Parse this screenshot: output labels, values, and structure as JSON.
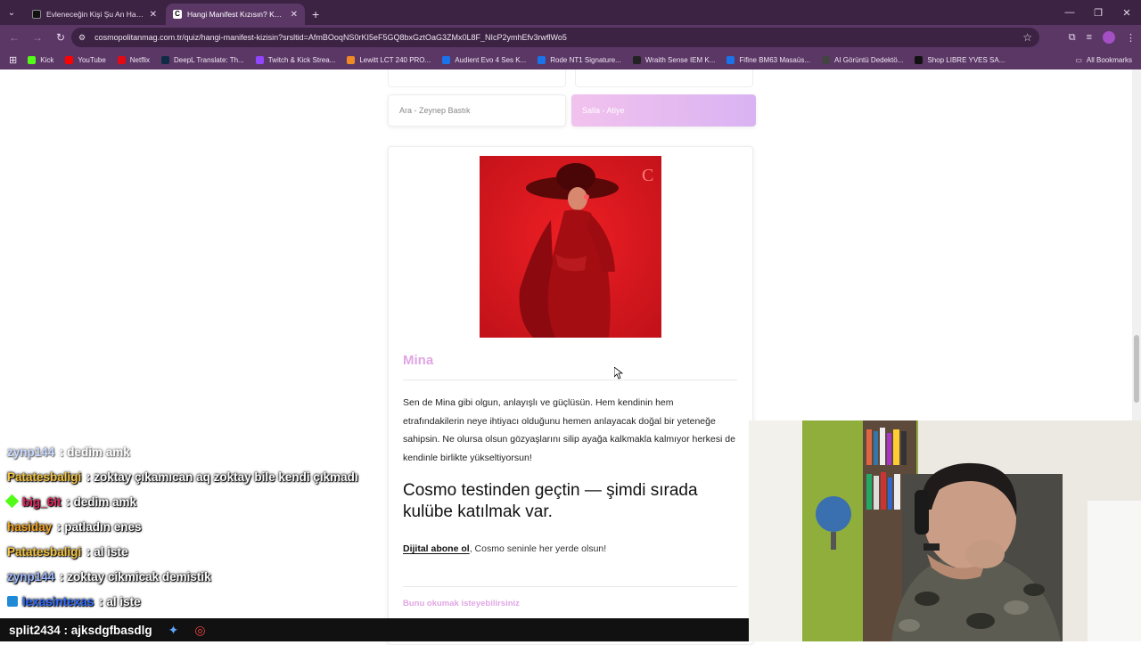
{
  "browser": {
    "tabs": [
      {
        "title": "Evleneceğin Kişi Şu An Hayatında mı?",
        "active": false
      },
      {
        "title": "Hangi Manifest Kızısın? Kendini Tanı",
        "active": true
      }
    ],
    "url": "cosmopolitanmag.com.tr/quiz/hangi-manifest-kizisin?srsltid=AfmBOoqNS0rKI5eF5GQ8bxGztOaG3ZMx0L8F_NIcP2ymhEfv3rwflWo5",
    "bookmarks": [
      {
        "label": "Kick",
        "color": "#53fc18"
      },
      {
        "label": "YouTube",
        "color": "#ff0000"
      },
      {
        "label": "Netflix",
        "color": "#e50914"
      },
      {
        "label": "DeepL Translate: Th...",
        "color": "#0f2b46"
      },
      {
        "label": "Twitch & Kick Strea...",
        "color": "#9146ff"
      },
      {
        "label": "Lewitt LCT 240 PRO...",
        "color": "#f08a24"
      },
      {
        "label": "Audient Evo 4 Ses K...",
        "color": "#1a73e8"
      },
      {
        "label": "Rode NT1 Signature...",
        "color": "#1a73e8"
      },
      {
        "label": "Wraith Sense IEM K...",
        "color": "#222222"
      },
      {
        "label": "Fifine BM63 Masaüs...",
        "color": "#1a73e8"
      },
      {
        "label": "AI Görüntü Dedektö...",
        "color": "#444444"
      },
      {
        "label": "Shop LIBRE YVES SA...",
        "color": "#111111"
      }
    ],
    "all_bookmarks": "All Bookmarks"
  },
  "page": {
    "options": [
      {
        "label": "Ara - Zeynep Bastık",
        "selected": false
      },
      {
        "label": "Salla - Atiye",
        "selected": true
      }
    ],
    "result": {
      "name": "Mina",
      "description": "Sen de Mina gibi olgun, anlayışlı ve güçlüsün. Hem kendinin hem etrafındakilerin neye ihtiyacı olduğunu hemen anlayacak doğal bir yeteneğe sahipsin. Ne olursa olsun gözyaşlarını silip ayağa kalkmakla kalmıyor herkesi de kendinle birlikte yükseltiyorsun!"
    },
    "promo": {
      "heading": "Cosmo testinden geçtin — şimdi sırada kulübe katılmak var.",
      "link": "Dijital abone ol",
      "tail": ", Cosmo seninle her yerde olsun!"
    },
    "more_heading": "Bunu okumak isteyebilirsiniz"
  },
  "chat": [
    {
      "user": "zynp144",
      "msg": "dedim amk",
      "color": "#9bb7ff",
      "badge": false
    },
    {
      "user": "Patatesbaligi",
      "msg": "zoktay çıkamıcan aq zoktay bile kendi çıkmadı",
      "color": "#f5c542",
      "badge": false
    },
    {
      "user": "big_6it",
      "msg": "dedim amk",
      "color": "#e0245e",
      "badge": true,
      "badge_color": "#53fc18"
    },
    {
      "user": "hasiday",
      "msg": "patladın enes",
      "color": "#f5a623",
      "badge": false
    },
    {
      "user": "Patatesbaligi",
      "msg": "al iste",
      "color": "#f5c542",
      "badge": false
    },
    {
      "user": "zynp144",
      "msg": "zoktay cikmicak demistik",
      "color": "#9bb7ff",
      "badge": false
    },
    {
      "user": "lexasintexas",
      "msg": "al iste",
      "color": "#2f6bff",
      "badge": true,
      "badge_color": "#1f8bd6"
    }
  ],
  "taskbar": {
    "user": "split2434",
    "msg": "ajksdgfbasdlg"
  },
  "colors": {
    "accent": "#e0a6e4",
    "chrome": "#5b3766",
    "tabbar": "#3c2343"
  }
}
